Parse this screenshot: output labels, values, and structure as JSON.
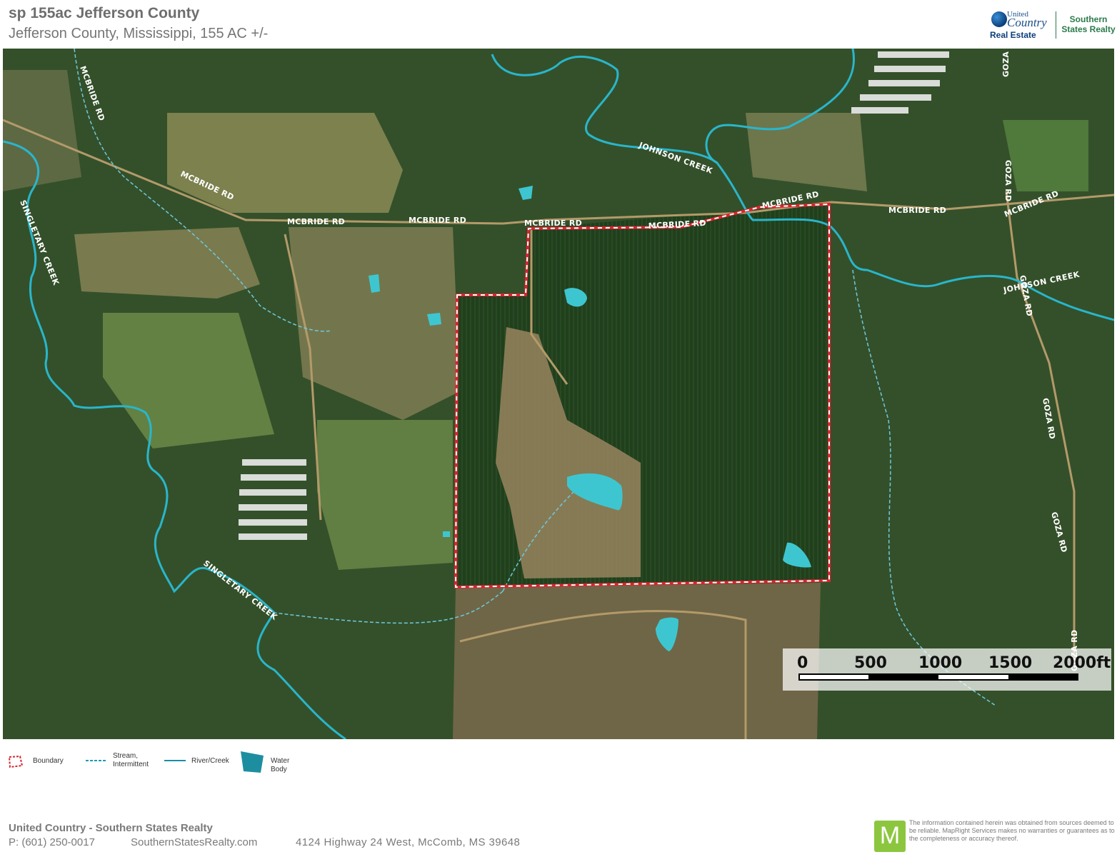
{
  "header": {
    "title": "sp 155ac Jefferson County",
    "subtitle": "Jefferson County, Mississippi, 155 AC +/-"
  },
  "logo": {
    "united": "United",
    "country": "Country",
    "real_estate": "Real Estate",
    "southern": "Southern",
    "states_realty": "States Realty"
  },
  "map": {
    "roads": {
      "mcbride_rd": "MCBRIDE RD",
      "goza_rd": "GOZA RD"
    },
    "creeks": {
      "johnson_creek": "JOHNSON CREEK",
      "singletary_creek": "SINGLETARY CREEK"
    },
    "colors": {
      "boundary": "#d9232e",
      "water": "#3ec6d0",
      "creek": "#29b6cc",
      "stream": "#6fc9dc"
    },
    "scale": {
      "ticks": [
        "0",
        "500",
        "1000",
        "1500",
        "2000ft"
      ]
    }
  },
  "legend": {
    "boundary": "Boundary",
    "stream_line1": "Stream,",
    "stream_line2": "Intermittent",
    "river": "River/Creek",
    "water": "Water Body"
  },
  "footer": {
    "company": "United Country - Southern States Realty",
    "phone": "P: (601) 250-0017",
    "website": "SouthernStatesRealty.com",
    "address": "4124 Highway 24 West, McComb, MS 39648",
    "mapright_letter": "M",
    "disclaimer": "The information contained herein was obtained from sources deemed to be reliable. MapRight Services makes no warranties or guarantees as to the completeness or accuracy thereof."
  }
}
